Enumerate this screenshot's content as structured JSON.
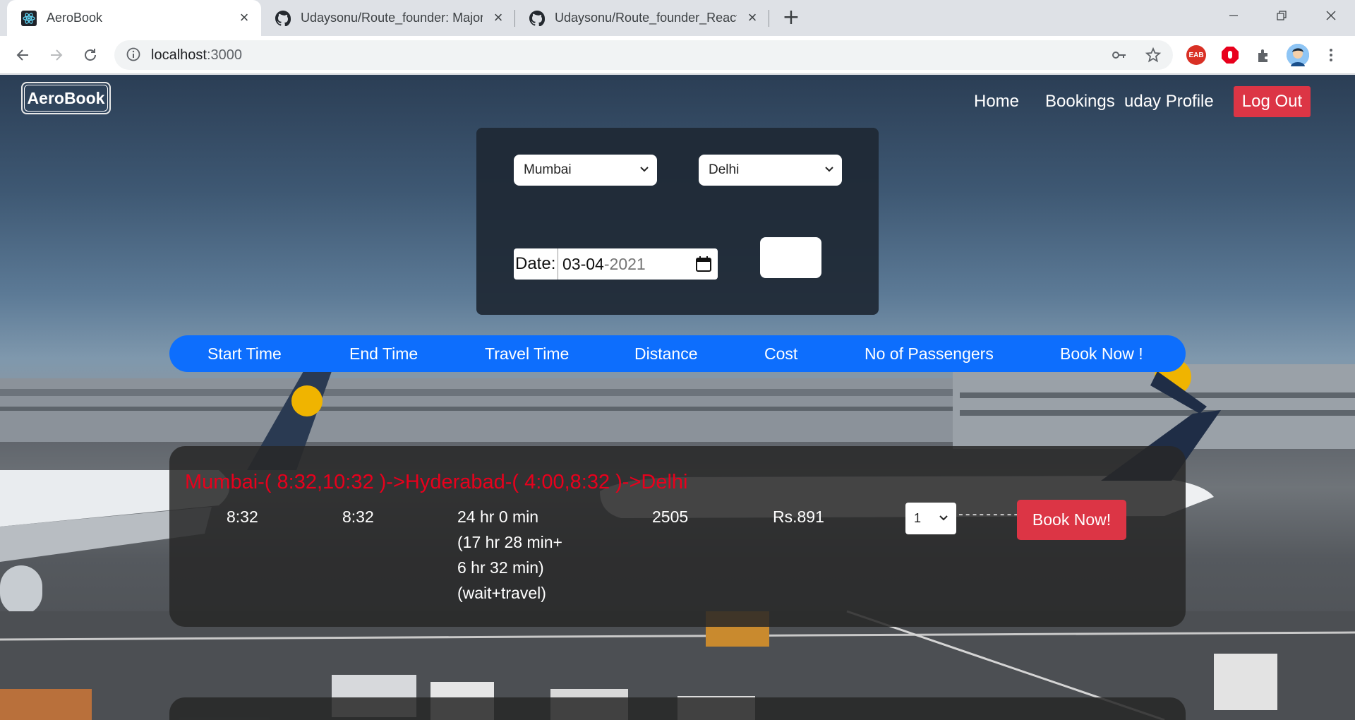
{
  "browser": {
    "tabs": [
      {
        "title": "AeroBook",
        "icon": "react-logo-icon",
        "active": true
      },
      {
        "title": "Udaysonu/Route_founder: Major",
        "icon": "github-icon",
        "active": false
      },
      {
        "title": "Udaysonu/Route_founder_React_",
        "icon": "github-icon",
        "active": false
      }
    ],
    "url_host": "localhost",
    "url_port": ":3000",
    "extensions": [
      "key-icon",
      "star-icon",
      "eab-extension-icon",
      "adblock-icon",
      "puzzle-icon",
      "profile-avatar"
    ]
  },
  "navbar": {
    "brand": "AeroBook",
    "links": [
      "Home",
      "Bookings",
      "uday Profile"
    ],
    "logout": "Log Out"
  },
  "search": {
    "from": "Mumbai",
    "to": "Delhi",
    "date_label": "Date:",
    "date_day": "03",
    "date_month": "04",
    "date_year": "2021"
  },
  "table_header": [
    "Start Time",
    "End Time",
    "Travel Time",
    "Distance",
    "Cost",
    "No of Passengers",
    "Book Now !"
  ],
  "result": {
    "route": "Mumbai-( 8:32,10:32 )->Hyderabad-( 4:00,8:32 )->Delhi",
    "start_time": "8:32",
    "end_time": "8:32",
    "travel_time_lines": [
      "24 hr 0 min",
      "(17 hr 28 min+",
      "6 hr 32 min)",
      "(wait+travel)"
    ],
    "distance": "2505",
    "cost": "Rs.891",
    "passengers": "1",
    "dashes": "---------",
    "book_label": "Book Now!"
  },
  "colors": {
    "primary_blue": "#0d6efd",
    "danger_red": "#dc3545",
    "route_red": "#e8001c"
  }
}
